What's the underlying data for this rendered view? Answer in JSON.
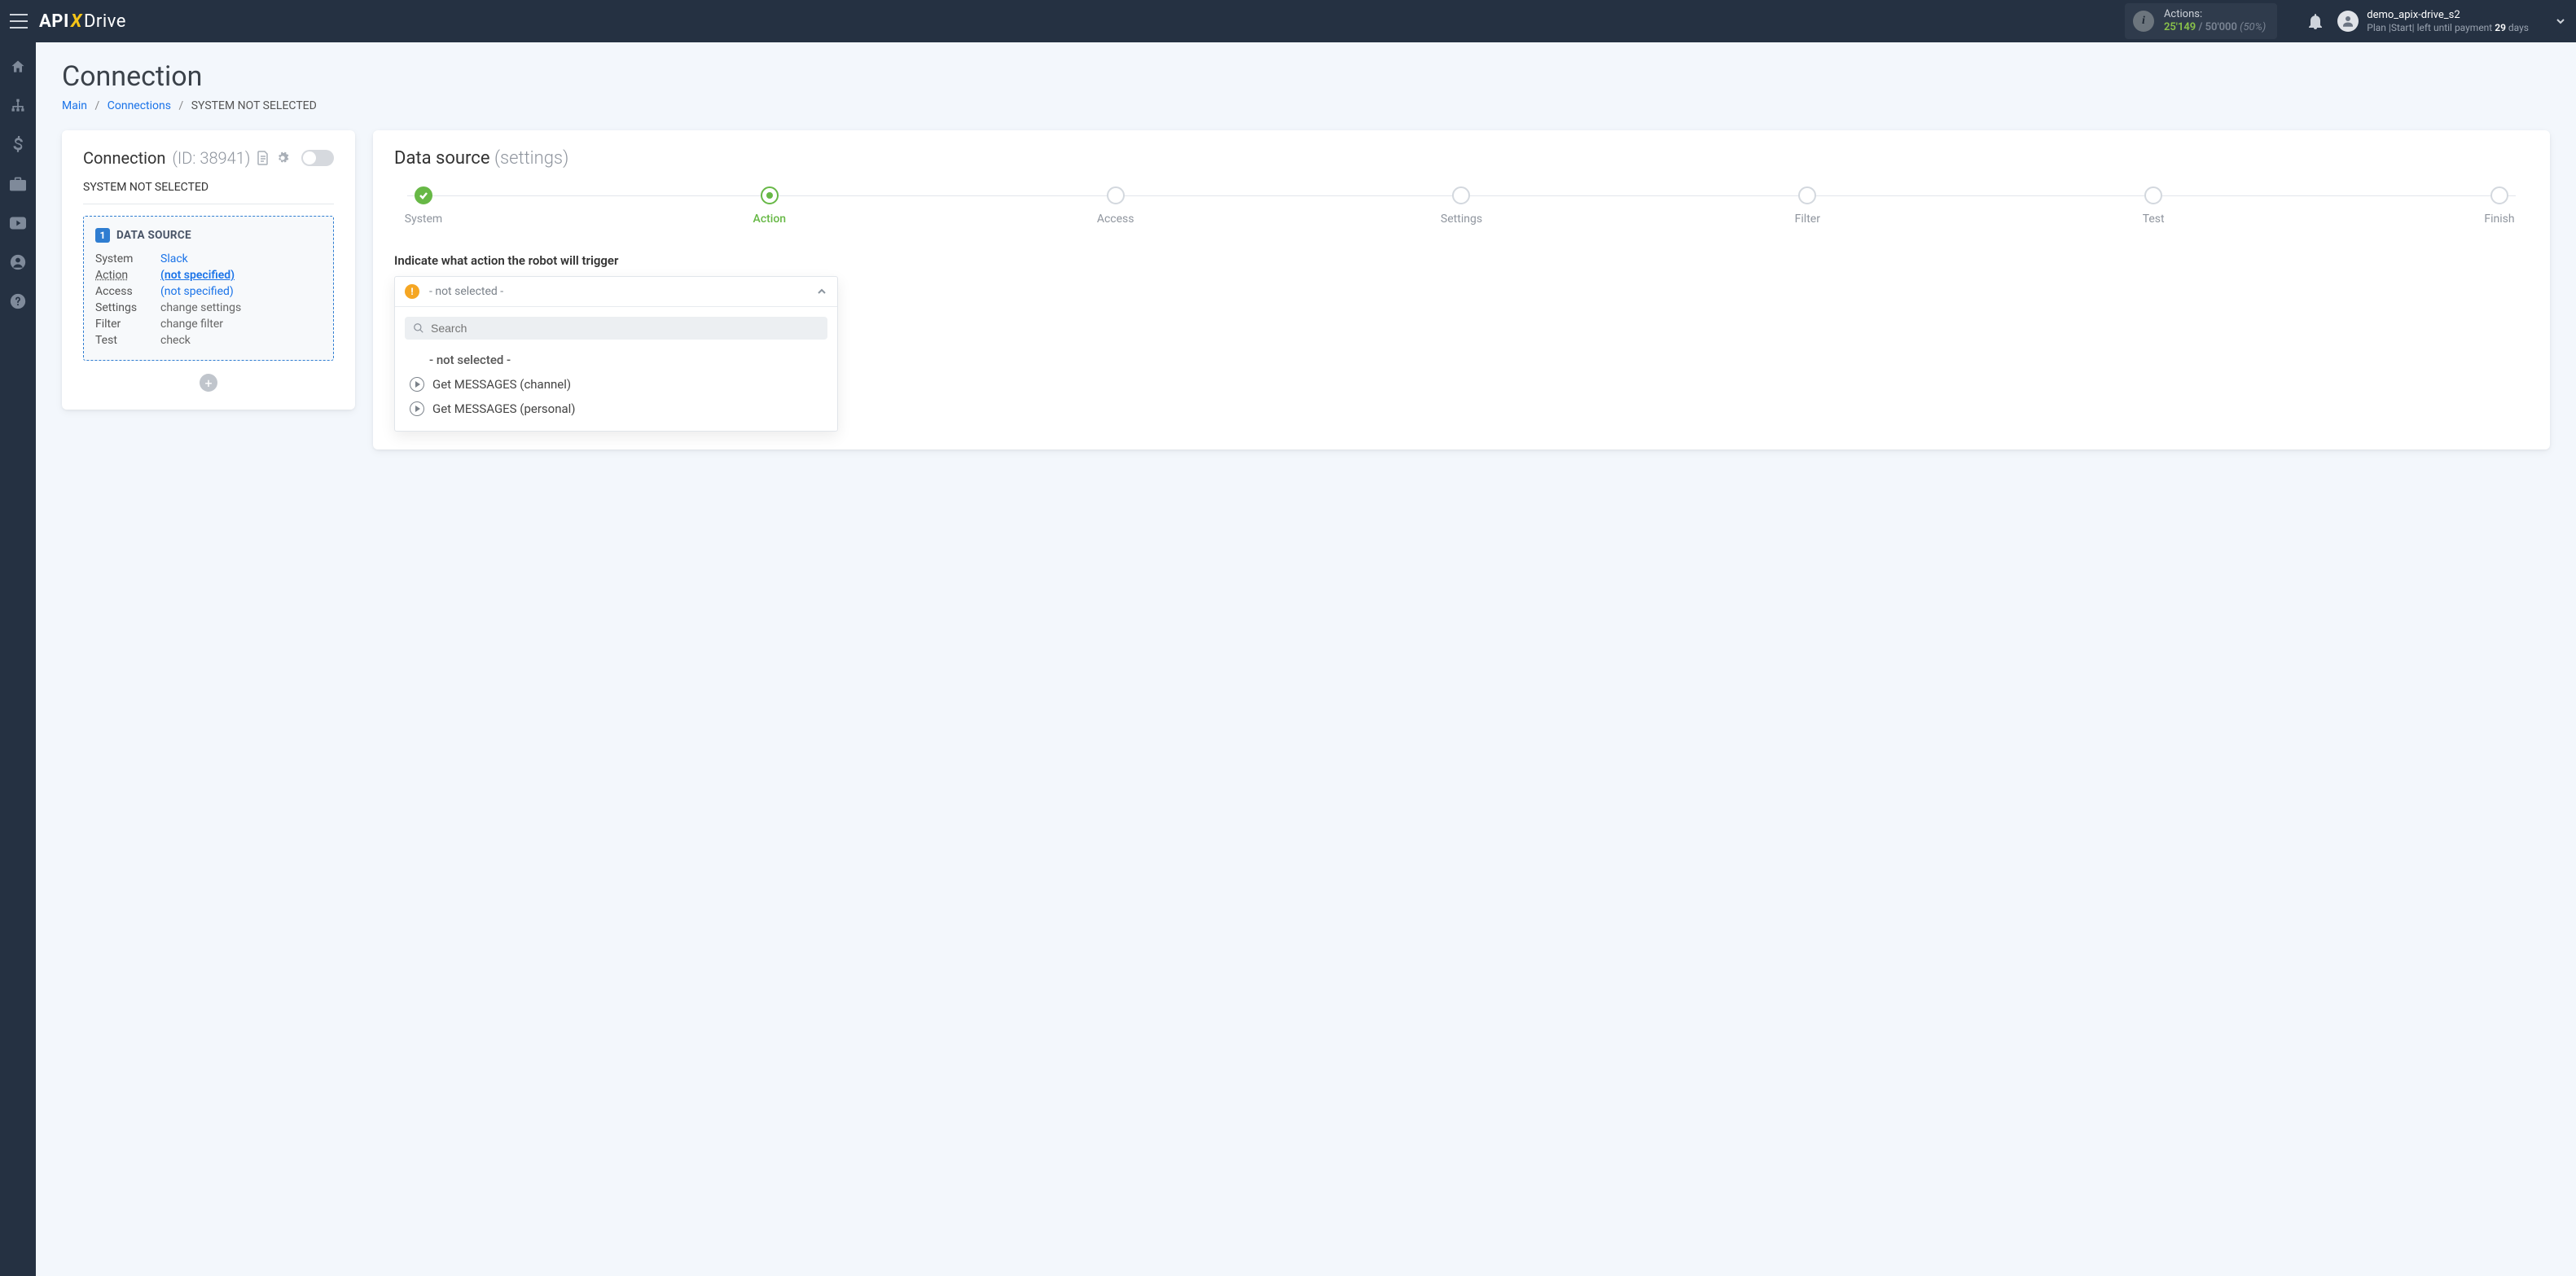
{
  "topbar": {
    "actions_label": "Actions:",
    "actions_used": "25'149 ",
    "actions_total": "/ 50'000 ",
    "actions_percent": "(50%)",
    "username": "demo_apix-drive_s2",
    "plan_prefix": "Plan ",
    "plan_name": "|Start|",
    "plan_middle": " left until payment ",
    "plan_days": "29",
    "plan_suffix": " days"
  },
  "page": {
    "title": "Connection",
    "crumb_main": "Main",
    "crumb_connections": "Connections",
    "crumb_current": "SYSTEM NOT SELECTED"
  },
  "left": {
    "title": "Connection",
    "id_text": "(ID: 38941)",
    "subtitle": "SYSTEM NOT SELECTED",
    "box_number": "1",
    "box_title": "DATA SOURCE",
    "rows": {
      "system_label": "System",
      "system_value": "Slack",
      "action_label": "Action",
      "action_value": "(not specified)",
      "access_label": "Access",
      "access_value": "(not specified)",
      "settings_label": "Settings",
      "settings_value": "change settings",
      "filter_label": "Filter",
      "filter_value": "change filter",
      "test_label": "Test",
      "test_value": "check"
    }
  },
  "right": {
    "title": "Data source",
    "subtitle": "(settings)",
    "steps": [
      "System",
      "Action",
      "Access",
      "Settings",
      "Filter",
      "Test",
      "Finish"
    ],
    "field_label": "Indicate what action the robot will trigger",
    "selected_value": "- not selected -",
    "search_placeholder": "Search",
    "options": {
      "none": "- not selected -",
      "opt1": "Get MESSAGES (channel)",
      "opt2": "Get MESSAGES (personal)"
    }
  }
}
